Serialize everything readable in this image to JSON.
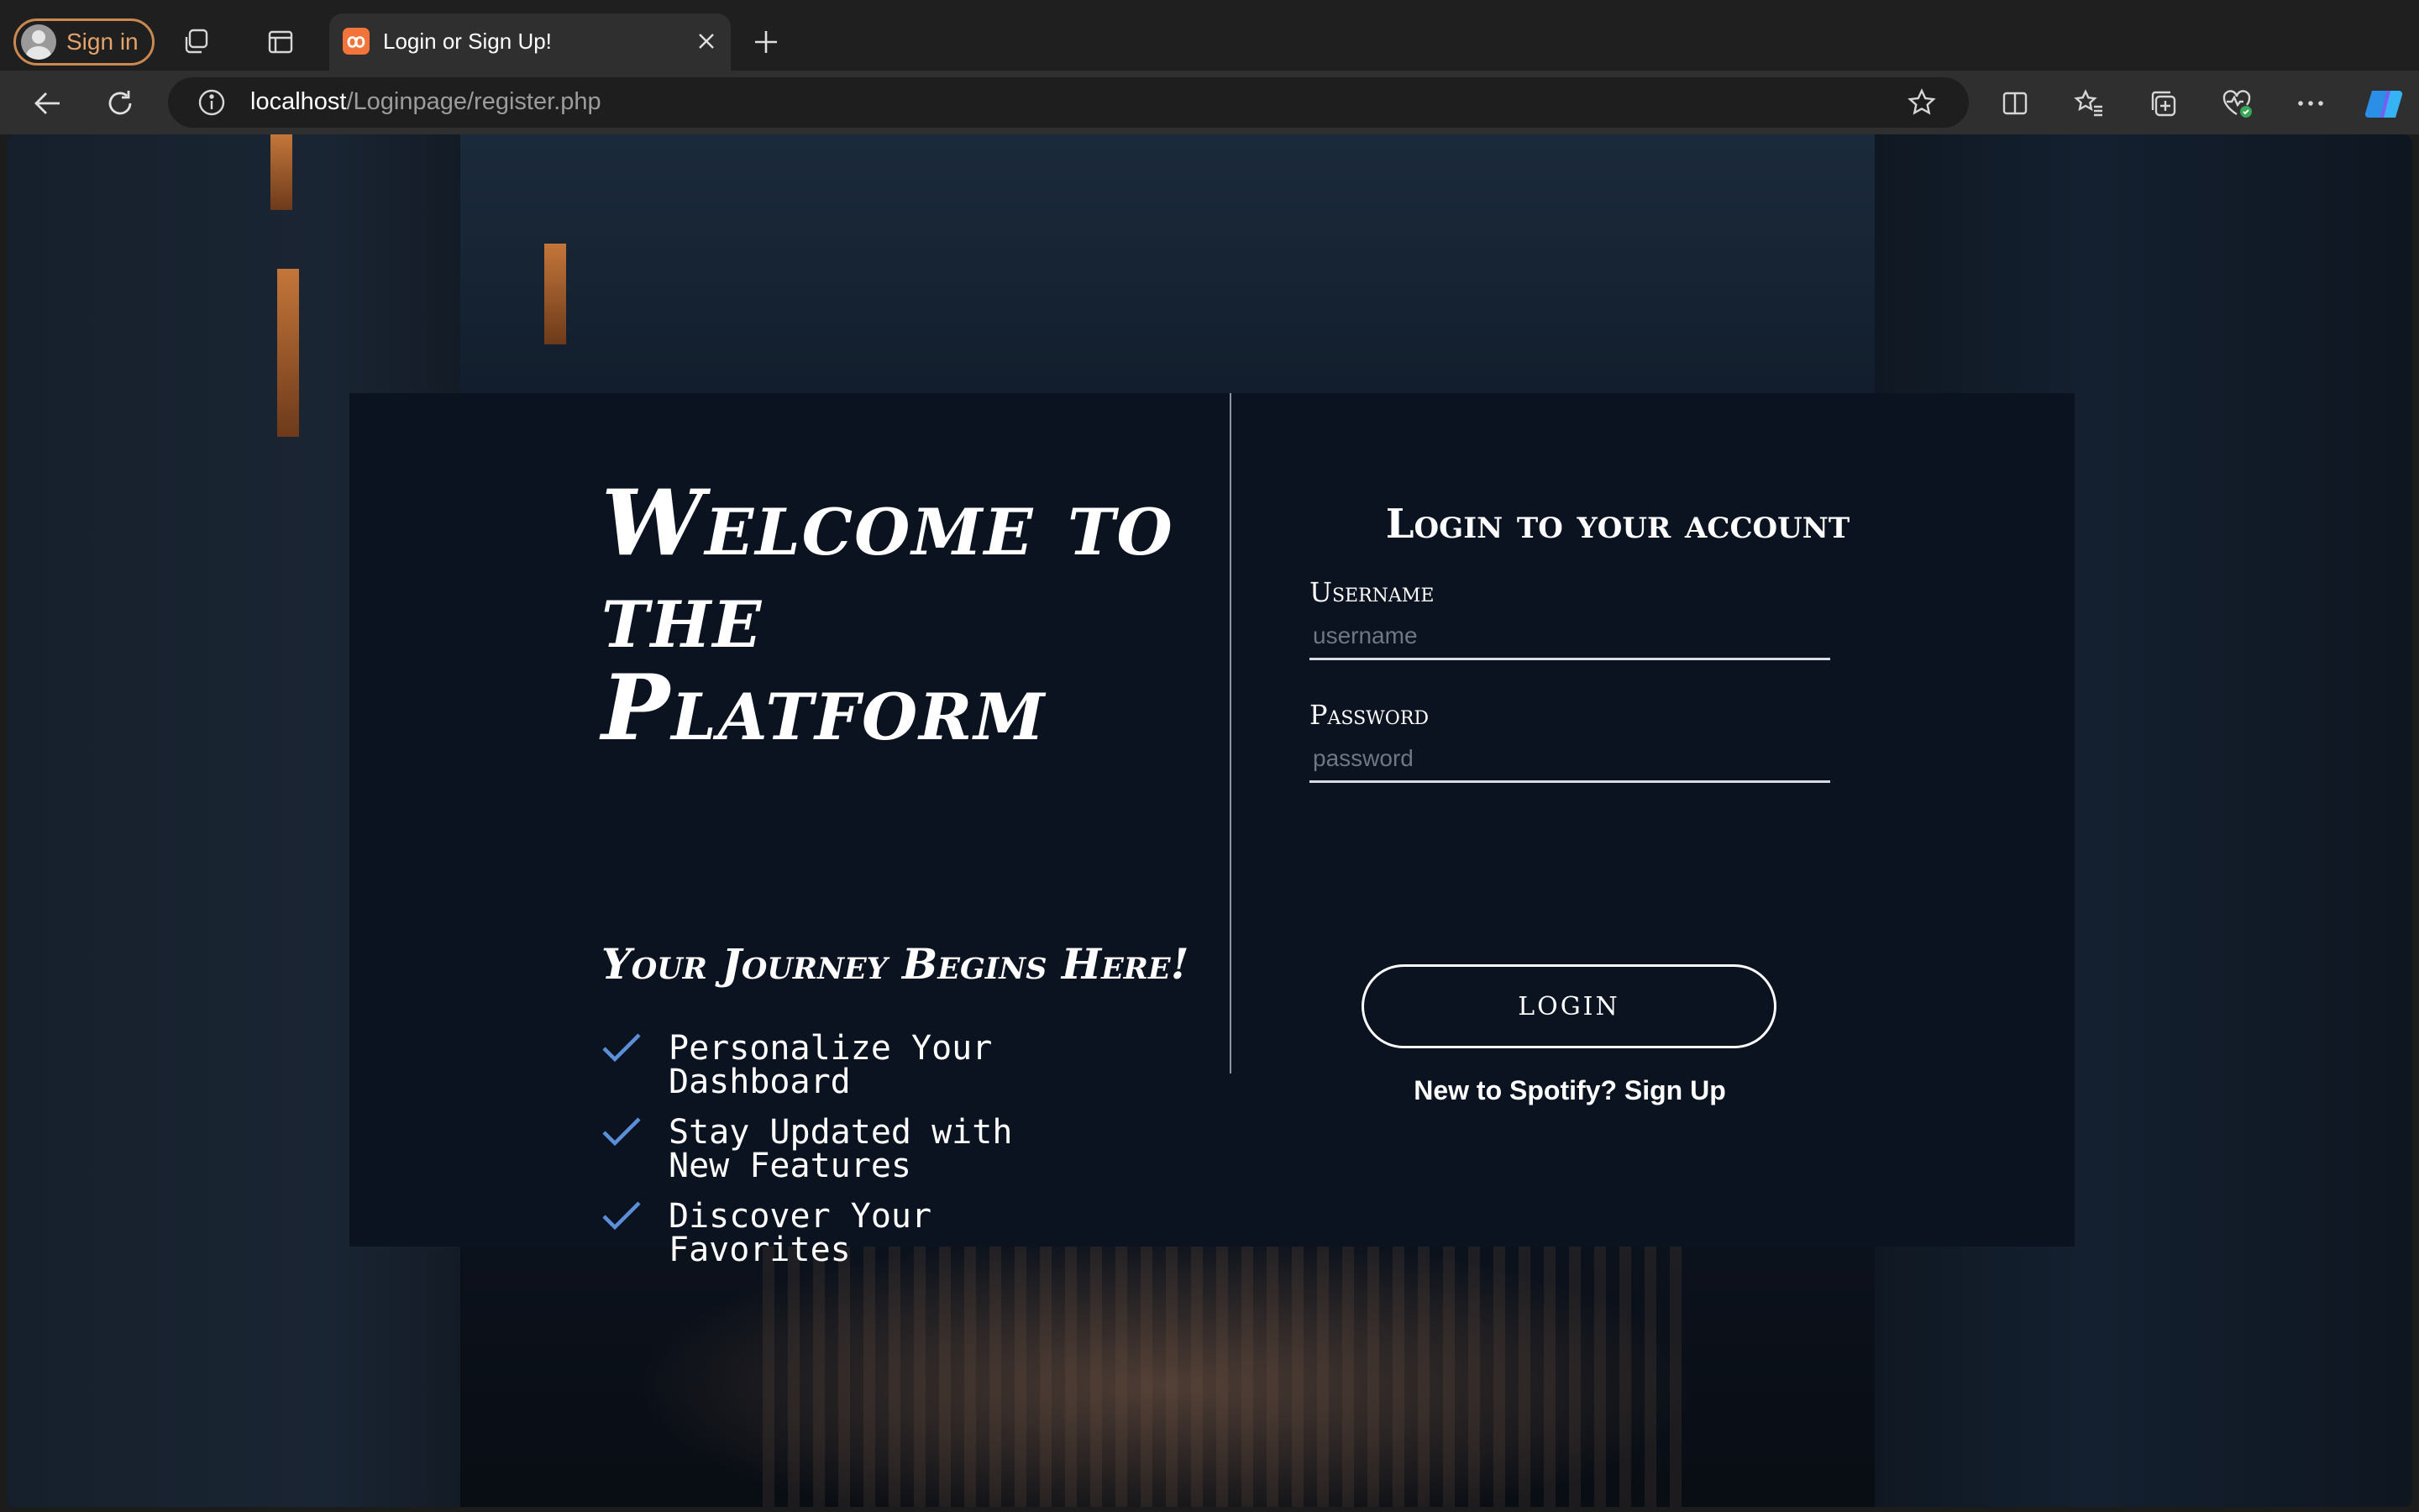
{
  "browser": {
    "profile_label": "Sign in",
    "tab_title": "Login or Sign Up!",
    "url_host": "localhost",
    "url_path": "/Loginpage/register.php",
    "icons": [
      "workspaces-icon",
      "tab-actions-icon",
      "close-icon",
      "new-tab-icon",
      "back-icon",
      "refresh-icon",
      "site-info-icon",
      "favorite-star-icon",
      "split-screen-icon",
      "favorites-icon",
      "collections-icon",
      "browser-essentials-icon",
      "more-icon",
      "copilot-icon"
    ]
  },
  "hero": {
    "title": "Welcome to the Platform",
    "tagline": "Your Journey Begins Here!",
    "features": [
      {
        "text": "Personalize Your Dashboard"
      },
      {
        "text": "Stay Updated with New Features"
      },
      {
        "text": "Discover Your Favorites"
      }
    ],
    "check_color": "#5b8fd8"
  },
  "login": {
    "title": "Login to your account",
    "username_label": "Username",
    "username_placeholder": "username",
    "password_label": "Password",
    "password_placeholder": "password",
    "button_label": "LOGIN",
    "signup_text": "New to Spotify? Sign Up"
  },
  "colors": {
    "card_bg": "#0b1220",
    "profile_accent": "#e5a36b",
    "tab_favicon": "#f2743a"
  }
}
